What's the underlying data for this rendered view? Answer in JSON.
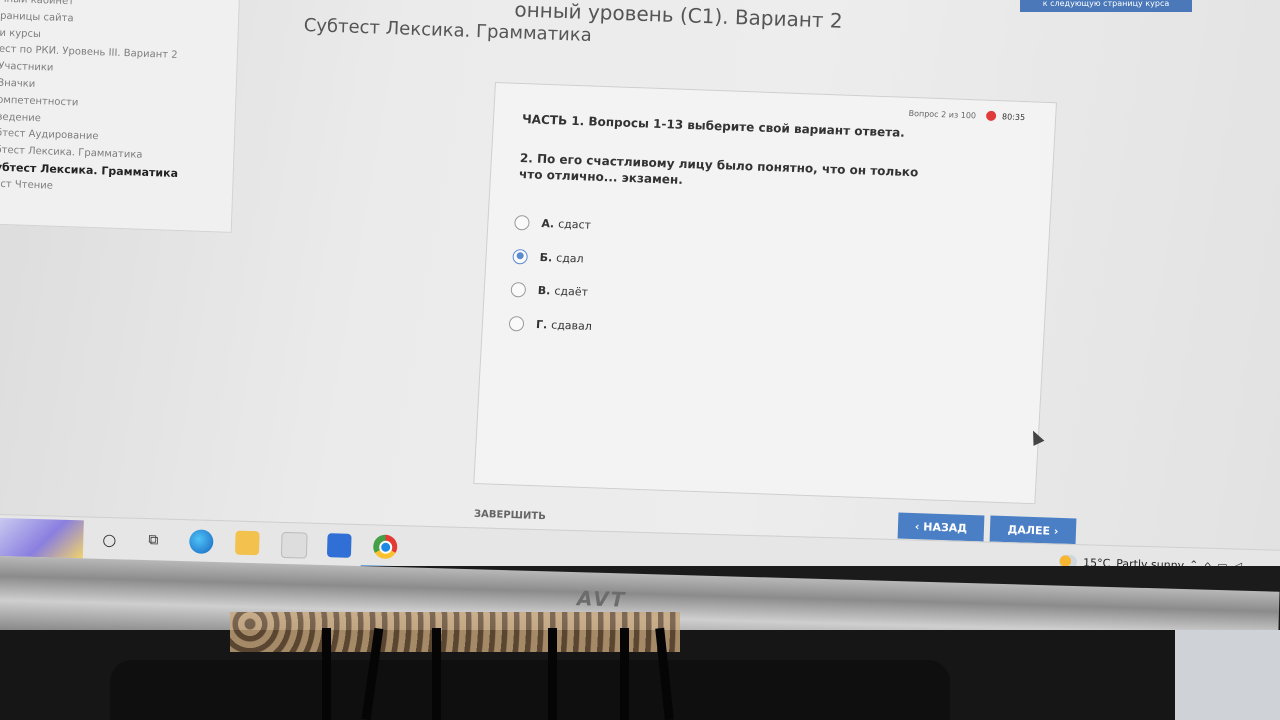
{
  "heading": {
    "title": "онный уровень (С1). Вариант 2",
    "subtitle": "Субтест Лексика. Грамматика"
  },
  "top_button": "к следующую страницу курса",
  "sidebar": {
    "items": [
      {
        "label": "чный кабинет"
      },
      {
        "label": "раницы сайта"
      },
      {
        "label": "и курсы"
      },
      {
        "label": "ест по РКИ. Уровень III. Вариант 2"
      },
      {
        "label": "Участники"
      },
      {
        "label": "Значки"
      },
      {
        "label": "омпетентности"
      },
      {
        "label": "ведение"
      },
      {
        "label": "бтест Аудирование"
      },
      {
        "label": "бтест Лексика. Грамматика"
      },
      {
        "label": "убтест Лексика. Грамматика",
        "active": true
      },
      {
        "label": "ест Чтение"
      }
    ]
  },
  "quiz": {
    "progress": "Вопрос 2 из 100",
    "timer": "80:35",
    "part": "ЧАСТЬ 1. Вопросы 1-13 выберите свой вариант ответа.",
    "question": "2. По его счастливому лицу было понятно, что он только что отлично...  экзамен.",
    "options": [
      {
        "letter": "А.",
        "text": "сдаст",
        "selected": false
      },
      {
        "letter": "Б.",
        "text": "сдал",
        "selected": true
      },
      {
        "letter": "В.",
        "text": "сдаёт",
        "selected": false
      },
      {
        "letter": "Г.",
        "text": "сдавал",
        "selected": false
      }
    ]
  },
  "controls": {
    "finish": "ЗАВЕРШИТЬ",
    "back": "‹ НАЗАД",
    "next": "ДАЛЕЕ ›"
  },
  "taskbar": {
    "apps": [
      "search-icon",
      "task-view-icon",
      "edge-icon",
      "file-explorer-icon",
      "store-icon",
      "mail-icon",
      "chrome-icon"
    ],
    "weather": {
      "temp": "15°C",
      "condition": "Partly sunny"
    }
  },
  "monitor": {
    "brand": "AVT"
  },
  "colors": {
    "accent": "#4a7fc6",
    "timer": "#e03a3a",
    "selected_radio": "#5b8ad0"
  }
}
